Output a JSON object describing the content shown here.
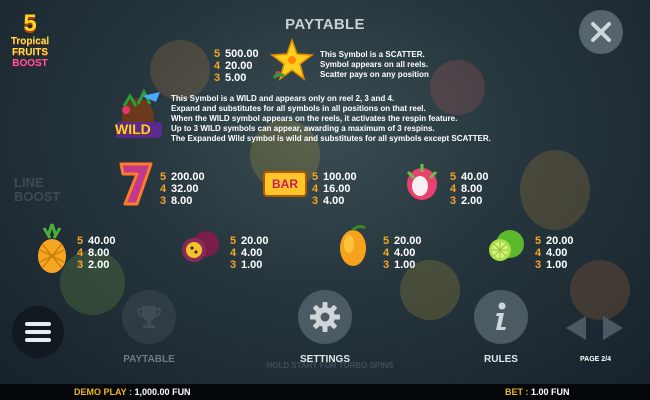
{
  "logo": {
    "number": "5",
    "line1": "Tropical",
    "line2": "FRUITS",
    "line3": "BOOST"
  },
  "title": "PAYTABLE",
  "scatter": {
    "pays": [
      {
        "count": "5",
        "value": "500.00"
      },
      {
        "count": "4",
        "value": "20.00"
      },
      {
        "count": "3",
        "value": "5.00"
      }
    ],
    "description": [
      "This Symbol is a SCATTER.",
      "Symbol appears on all reels.",
      "Scatter pays on any position"
    ]
  },
  "wild": {
    "label": "WILD",
    "description": [
      "This Symbol is a WILD and appears only on reel 2, 3 and 4.",
      "Expand and substitutes for all symbols in all positions on that reel.",
      "When the WILD symbol appears on the reels, it activates the respin feature.",
      "Up to 3 WILD symbols can appear, awarding a maximum of 3 respins.",
      "The Expanded Wild symbol is wild and substitutes for all symbols except SCATTER."
    ]
  },
  "symbols": [
    {
      "name": "seven",
      "pays": [
        {
          "count": "5",
          "value": "200.00"
        },
        {
          "count": "4",
          "value": "32.00"
        },
        {
          "count": "3",
          "value": "8.00"
        }
      ]
    },
    {
      "name": "bar",
      "label": "BAR",
      "pays": [
        {
          "count": "5",
          "value": "100.00"
        },
        {
          "count": "4",
          "value": "16.00"
        },
        {
          "count": "3",
          "value": "4.00"
        }
      ]
    },
    {
      "name": "dragonfruit",
      "pays": [
        {
          "count": "5",
          "value": "40.00"
        },
        {
          "count": "4",
          "value": "8.00"
        },
        {
          "count": "3",
          "value": "2.00"
        }
      ]
    },
    {
      "name": "pineapple",
      "pays": [
        {
          "count": "5",
          "value": "40.00"
        },
        {
          "count": "4",
          "value": "8.00"
        },
        {
          "count": "3",
          "value": "2.00"
        }
      ]
    },
    {
      "name": "passionfruit",
      "pays": [
        {
          "count": "5",
          "value": "20.00"
        },
        {
          "count": "4",
          "value": "4.00"
        },
        {
          "count": "3",
          "value": "1.00"
        }
      ]
    },
    {
      "name": "mango",
      "pays": [
        {
          "count": "5",
          "value": "20.00"
        },
        {
          "count": "4",
          "value": "4.00"
        },
        {
          "count": "3",
          "value": "1.00"
        }
      ]
    },
    {
      "name": "lime",
      "pays": [
        {
          "count": "5",
          "value": "20.00"
        },
        {
          "count": "4",
          "value": "4.00"
        },
        {
          "count": "3",
          "value": "1.00"
        }
      ]
    }
  ],
  "buttons": {
    "paytable": "PAYTABLE",
    "settings": "SETTINGS",
    "rules": "RULES"
  },
  "background_text": {
    "line_boost": "LINE BOOST",
    "hold_hint": "HOLD START FOR TURBO SPINS"
  },
  "page": "PAGE 2/4",
  "footer": {
    "demo_label": "DEMO PLAY :",
    "balance": "1,000.00 FUN",
    "bet_label": "BET :",
    "bet": "1.00 FUN"
  },
  "colors": {
    "accent": "#f5a623",
    "footer_accent": "#f0b323",
    "button": "#4c5a63"
  }
}
